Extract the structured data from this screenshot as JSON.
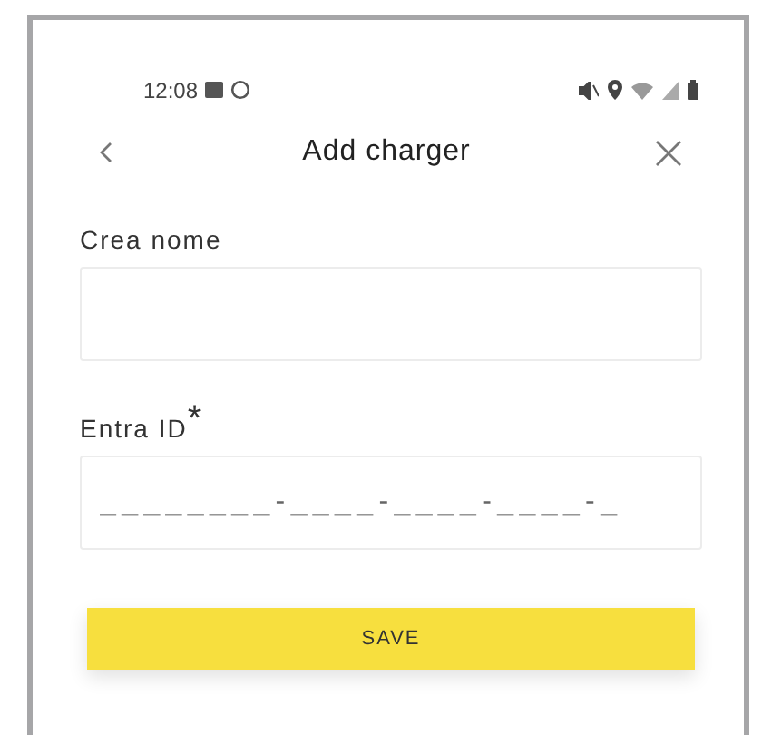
{
  "status_bar": {
    "time": "12:08"
  },
  "header": {
    "title": "Add charger"
  },
  "fields": [
    {
      "label": "Crea nome"
    },
    {
      "label": "Entra ID$^{*}$",
      "placeholder": "________-____-____-____-_"
    }
  ],
  "save_button": {
    "label": "SAVE"
  }
}
